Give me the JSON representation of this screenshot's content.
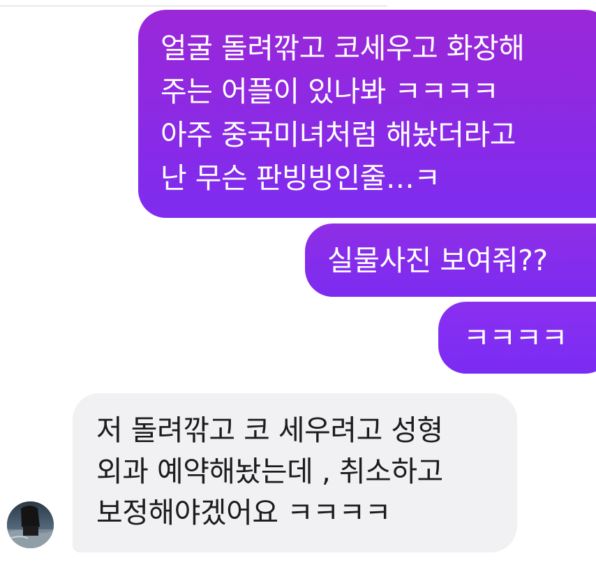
{
  "conversation": {
    "messages": [
      {
        "sender": "me",
        "lines": [
          "얼굴 돌려깎고 코세우고 화장해",
          "주는 어플이 있나봐 ㅋㅋㅋㅋ",
          "아주 중국미녀처럼 해놨더라고",
          "난 무슨 판빙빙인줄…ㅋ"
        ]
      },
      {
        "sender": "me",
        "lines": [
          "실물사진 보여줘??"
        ]
      },
      {
        "sender": "me",
        "lines": [
          "ㅋㅋㅋㅋ"
        ]
      },
      {
        "sender": "other",
        "lines": [
          "저 돌려깎고 코 세우려고 성형",
          "외과 예약해놨는데 , 취소하고",
          "보정해야겠어요 ㅋㅋㅋㅋ"
        ]
      }
    ]
  },
  "colors": {
    "sent_bubble_top": "#9b27d8",
    "sent_bubble_bottom": "#7e2cf0",
    "received_bubble": "#f1f1f4",
    "received_text": "#1c1c1e"
  }
}
